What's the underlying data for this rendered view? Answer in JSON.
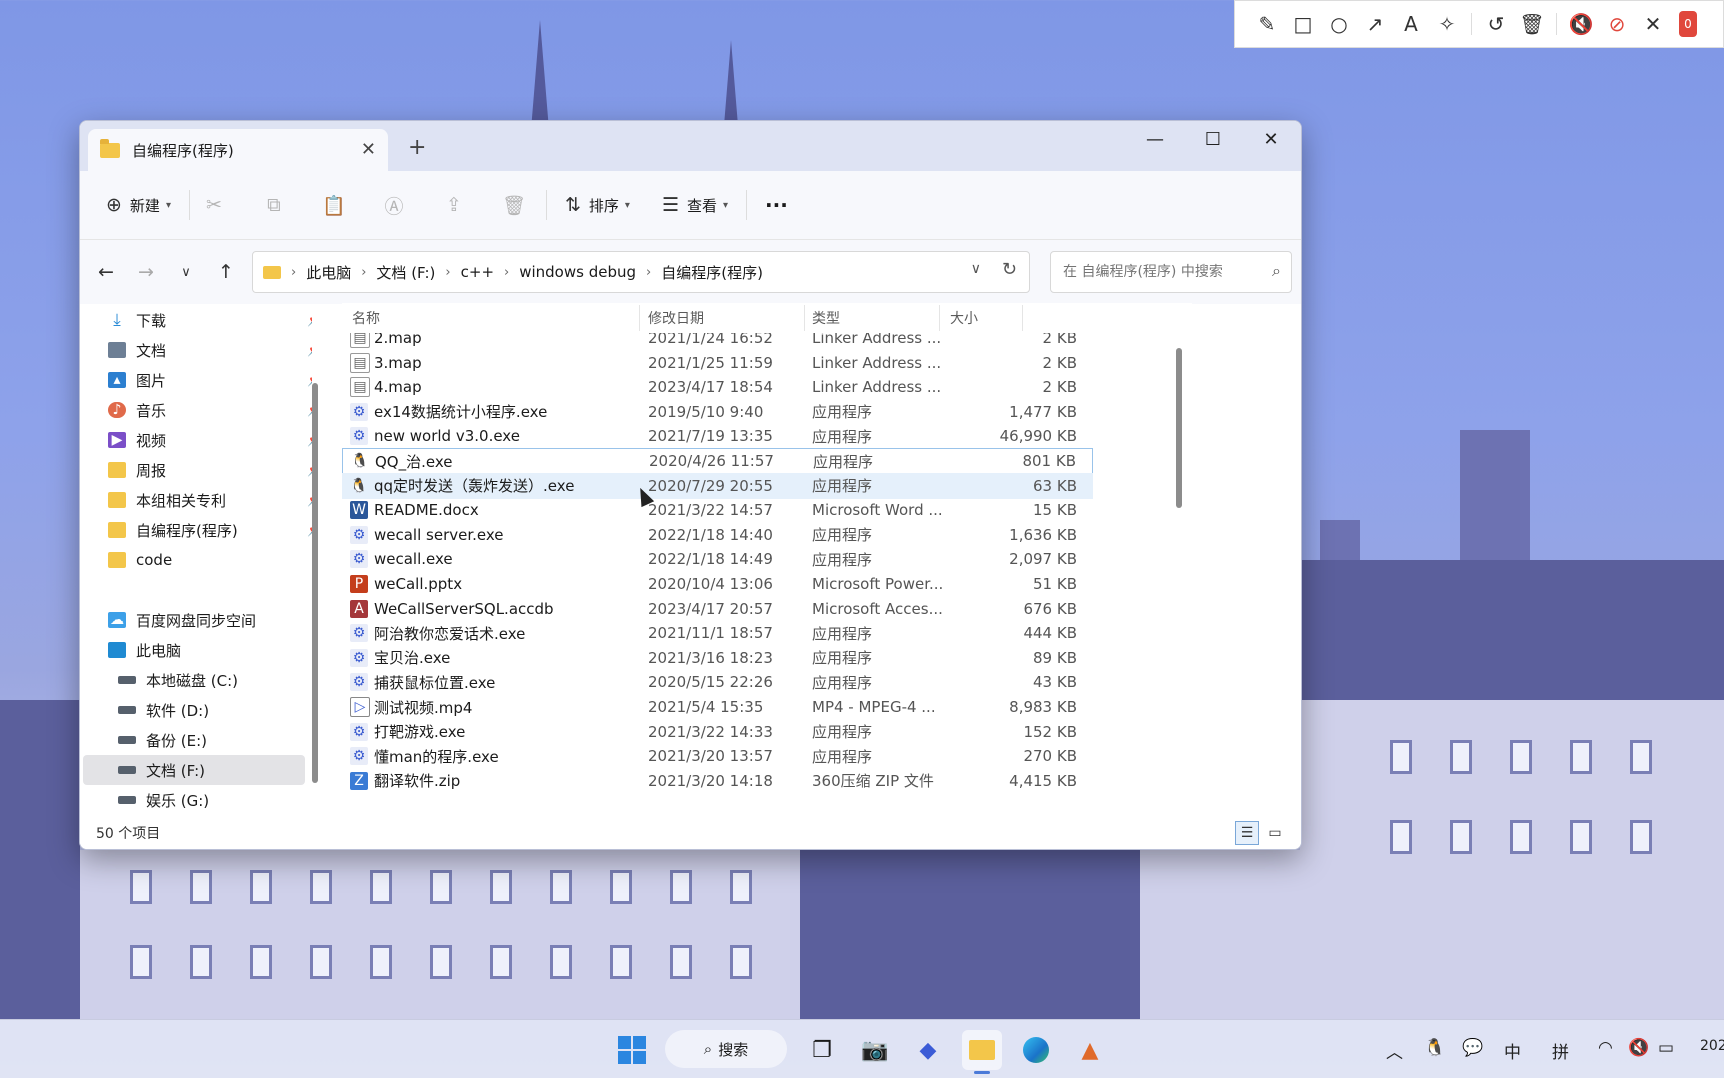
{
  "capture_toolbar": {
    "tools": [
      "pencil-icon",
      "rectangle-icon",
      "circle-icon",
      "arrow-icon",
      "text-icon",
      "magic-wand-icon",
      "undo-icon",
      "trash-icon",
      "speaker-mute-icon",
      "mic-mute-icon",
      "close-icon"
    ],
    "stop_label": "0"
  },
  "window": {
    "tab_title": "自编程序(程序)",
    "new_tab": "+",
    "minimize": "—",
    "maximize": "☐",
    "close": "✕"
  },
  "toolbar": {
    "new_label": "新建",
    "sort_label": "排序",
    "view_label": "查看",
    "more_label": "···"
  },
  "address": {
    "crumbs": [
      "此电脑",
      "文档 (F:)",
      "c++",
      "windows debug",
      "自编程序(程序)"
    ]
  },
  "search": {
    "placeholder": "在 自编程序(程序) 中搜索"
  },
  "sidebar": {
    "quick": [
      {
        "label": "下载",
        "icon": "download-icon",
        "color": "#2a8bd6"
      },
      {
        "label": "文档",
        "icon": "document-icon",
        "color": "#6d7f95"
      },
      {
        "label": "图片",
        "icon": "picture-icon",
        "color": "#2c7fd0"
      },
      {
        "label": "音乐",
        "icon": "music-icon",
        "color": "#e06a4a"
      },
      {
        "label": "视频",
        "icon": "video-icon",
        "color": "#7b4fc8"
      },
      {
        "label": "周报",
        "icon": "folder-icon",
        "color": "#f3c64a"
      },
      {
        "label": "本组相关专利",
        "icon": "folder-icon",
        "color": "#f3c64a"
      },
      {
        "label": "自编程序(程序)",
        "icon": "folder-icon",
        "color": "#f3c64a"
      },
      {
        "label": "code",
        "icon": "folder-icon",
        "color": "#f3c64a"
      }
    ],
    "cloud": "百度网盘同步空间",
    "this_pc": "此电脑",
    "drives": [
      "本地磁盘 (C:)",
      "软件 (D:)",
      "备份 (E:)",
      "文档 (F:)",
      "娱乐 (G:)"
    ]
  },
  "columns": {
    "name": "名称",
    "date": "修改日期",
    "type": "类型",
    "size": "大小"
  },
  "files": [
    {
      "name": "2.map",
      "date": "2021/1/24 16:52",
      "type": "Linker Address ...",
      "size": "2 KB",
      "icon": "text-file-icon"
    },
    {
      "name": "3.map",
      "date": "2021/1/25 11:59",
      "type": "Linker Address ...",
      "size": "2 KB",
      "icon": "text-file-icon"
    },
    {
      "name": "4.map",
      "date": "2023/4/17 18:54",
      "type": "Linker Address ...",
      "size": "2 KB",
      "icon": "text-file-icon"
    },
    {
      "name": "ex14数据统计小程序.exe",
      "date": "2019/5/10 9:40",
      "type": "应用程序",
      "size": "1,477 KB",
      "icon": "app-icon"
    },
    {
      "name": "new world v3.0.exe",
      "date": "2021/7/19 13:35",
      "type": "应用程序",
      "size": "46,990 KB",
      "icon": "app-icon"
    },
    {
      "name": "QQ_治.exe",
      "date": "2020/4/26 11:57",
      "type": "应用程序",
      "size": "801 KB",
      "icon": "qq-icon"
    },
    {
      "name": "qq定时发送（轰炸发送）.exe",
      "date": "2020/7/29 20:55",
      "type": "应用程序",
      "size": "63 KB",
      "icon": "qq-icon"
    },
    {
      "name": "README.docx",
      "date": "2021/3/22 14:57",
      "type": "Microsoft Word ...",
      "size": "15 KB",
      "icon": "word-icon"
    },
    {
      "name": "wecall server.exe",
      "date": "2022/1/18 14:40",
      "type": "应用程序",
      "size": "1,636 KB",
      "icon": "app-icon"
    },
    {
      "name": "wecall.exe",
      "date": "2022/1/18 14:49",
      "type": "应用程序",
      "size": "2,097 KB",
      "icon": "app-icon"
    },
    {
      "name": "weCall.pptx",
      "date": "2020/10/4 13:06",
      "type": "Microsoft Power...",
      "size": "51 KB",
      "icon": "powerpoint-icon"
    },
    {
      "name": "WeCallServerSQL.accdb",
      "date": "2023/4/17 20:57",
      "type": "Microsoft Acces...",
      "size": "676 KB",
      "icon": "access-icon"
    },
    {
      "name": "阿治教你恋爱话术.exe",
      "date": "2021/11/1 18:57",
      "type": "应用程序",
      "size": "444 KB",
      "icon": "app-icon"
    },
    {
      "name": "宝贝治.exe",
      "date": "2021/3/16 18:23",
      "type": "应用程序",
      "size": "89 KB",
      "icon": "app-icon"
    },
    {
      "name": "捕获鼠标位置.exe",
      "date": "2020/5/15 22:26",
      "type": "应用程序",
      "size": "43 KB",
      "icon": "app-icon"
    },
    {
      "name": "测试视频.mp4",
      "date": "2021/5/4 15:35",
      "type": "MP4 - MPEG-4 ...",
      "size": "8,983 KB",
      "icon": "video-file-icon"
    },
    {
      "name": "打靶游戏.exe",
      "date": "2021/3/22 14:33",
      "type": "应用程序",
      "size": "152 KB",
      "icon": "app-icon"
    },
    {
      "name": "懂man的程序.exe",
      "date": "2021/3/20 13:57",
      "type": "应用程序",
      "size": "270 KB",
      "icon": "app-icon"
    },
    {
      "name": "翻译软件.zip",
      "date": "2021/3/20 14:18",
      "type": "360压缩 ZIP 文件",
      "size": "4,415 KB",
      "icon": "zip-icon"
    }
  ],
  "status": {
    "count": "50 个项目"
  },
  "taskbar": {
    "search_label": "搜索",
    "ime_lang": "中",
    "ime_mode": "拼",
    "clock_partial": "202"
  }
}
